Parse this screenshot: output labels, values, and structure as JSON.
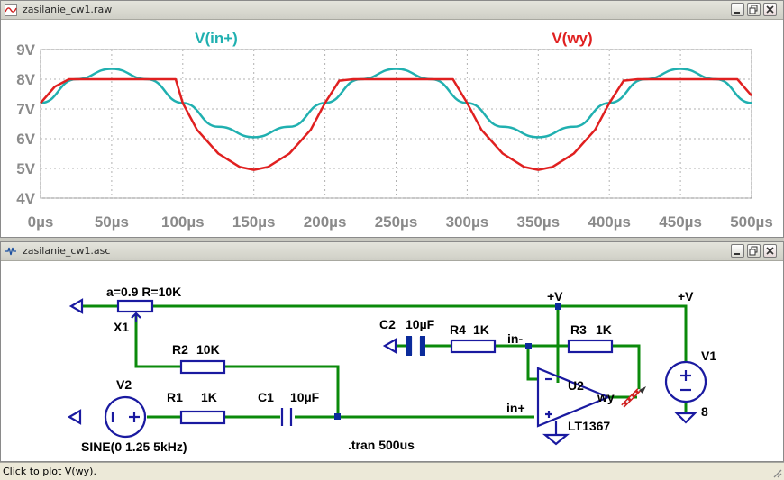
{
  "waveform_window": {
    "title": "zasilanie_cw1.raw",
    "icon": "waveform-icon",
    "trace_labels": [
      "V(in+)",
      "V(wy)"
    ],
    "trace_colors": {
      "V(in+)": "#20b0b0",
      "V(wy)": "#e02020"
    }
  },
  "schematic_window": {
    "title": "zasilanie_cw1.asc",
    "icon": "schematic-icon",
    "labels": {
      "pot": "a=0.9 R=10K",
      "x1": "X1",
      "r2": "R2",
      "r2_val": "10K",
      "v2": "V2",
      "r1": "R1",
      "r1_val": "1K",
      "c1": "C1",
      "c1_val": "10µF",
      "sine": "SINE(0 1.25 5kHz)",
      "tran": ".tran 500us",
      "c2": "C2",
      "c2_val": "10µF",
      "r4": "R4",
      "r4_val": "1K",
      "in_minus": "in-",
      "r3": "R3",
      "r3_val": "1K",
      "vplus_1": "+V",
      "vplus_2": "+V",
      "v1": "V1",
      "v1_val": "8",
      "u2": "U2",
      "opamp": "LT1367",
      "in_plus": "in+",
      "wy": "wy"
    }
  },
  "status_bar": {
    "text": "Click to plot V(wy)."
  },
  "chart_data": {
    "type": "line",
    "xlabel": "",
    "ylabel": "",
    "x_ticks": [
      "0µs",
      "50µs",
      "100µs",
      "150µs",
      "200µs",
      "250µs",
      "300µs",
      "350µs",
      "400µs",
      "450µs",
      "500µs"
    ],
    "y_ticks": [
      "4V",
      "5V",
      "6V",
      "7V",
      "8V",
      "9V"
    ],
    "xlim": [
      0,
      500
    ],
    "ylim": [
      4,
      9
    ],
    "grid": true,
    "series": [
      {
        "name": "V(in+)",
        "color": "#20b0b0",
        "x": [
          0,
          25,
          50,
          75,
          100,
          125,
          150,
          175,
          200,
          225,
          250,
          275,
          300,
          325,
          350,
          375,
          400,
          425,
          450,
          475,
          500
        ],
        "values": [
          7.2,
          8.0,
          8.35,
          8.0,
          7.2,
          6.4,
          6.05,
          6.4,
          7.2,
          8.0,
          8.35,
          8.0,
          7.2,
          6.4,
          6.05,
          6.4,
          7.2,
          8.0,
          8.35,
          8.0,
          7.2
        ]
      },
      {
        "name": "V(wy)",
        "color": "#e02020",
        "x": [
          0,
          10,
          20,
          30,
          50,
          80,
          95,
          100,
          110,
          125,
          140,
          150,
          160,
          175,
          190,
          200,
          210,
          220,
          250,
          290,
          300,
          310,
          325,
          340,
          350,
          360,
          375,
          390,
          400,
          410,
          420,
          450,
          490,
          500
        ],
        "values": [
          7.2,
          7.75,
          8.0,
          8.0,
          8.0,
          8.0,
          8.0,
          7.2,
          6.3,
          5.5,
          5.05,
          4.95,
          5.05,
          5.5,
          6.3,
          7.2,
          7.95,
          8.0,
          8.0,
          8.0,
          7.2,
          6.3,
          5.5,
          5.05,
          4.95,
          5.05,
          5.5,
          6.3,
          7.2,
          7.95,
          8.0,
          8.0,
          8.0,
          7.45
        ]
      }
    ]
  }
}
